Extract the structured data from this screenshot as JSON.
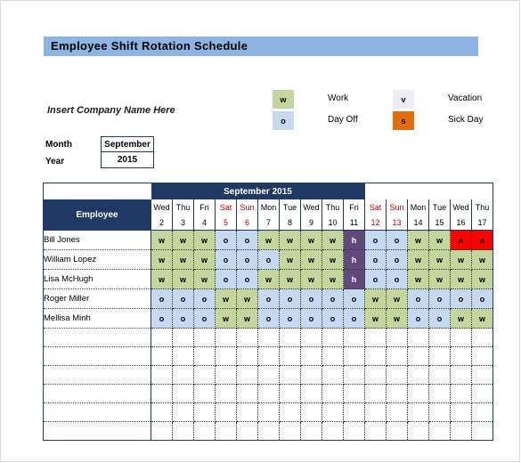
{
  "title": "Employee  Shift  Rotation  Schedule",
  "company_name": "Insert Company Name Here",
  "fields": {
    "month_label": "Month",
    "month_value": "September",
    "year_label": "Year",
    "year_value": "2015"
  },
  "legend": {
    "items": [
      {
        "code": "w",
        "label": "Work",
        "color": "#c3d69b",
        "text_color": "#000000"
      },
      {
        "code": "o",
        "label": "Day Off",
        "color": "#c5d9f1",
        "text_color": "#000000"
      },
      {
        "code": "v",
        "label": "Vacation",
        "color": "#eeecf4",
        "text_color": "#000000"
      },
      {
        "code": "s",
        "label": "Sick Day",
        "color": "#e36c0a",
        "text_color": "#000000"
      }
    ]
  },
  "table": {
    "month_banner": "September 2015",
    "employee_header": "Employee",
    "days": [
      {
        "dow": "Wed",
        "num": "2",
        "weekend": false
      },
      {
        "dow": "Thu",
        "num": "3",
        "weekend": false
      },
      {
        "dow": "Fri",
        "num": "4",
        "weekend": false
      },
      {
        "dow": "Sat",
        "num": "5",
        "weekend": true
      },
      {
        "dow": "Sun",
        "num": "6",
        "weekend": true
      },
      {
        "dow": "Mon",
        "num": "7",
        "weekend": false
      },
      {
        "dow": "Tue",
        "num": "8",
        "weekend": false
      },
      {
        "dow": "Wed",
        "num": "9",
        "weekend": false
      },
      {
        "dow": "Thu",
        "num": "10",
        "weekend": false
      },
      {
        "dow": "Fri",
        "num": "11",
        "weekend": false
      },
      {
        "dow": "Sat",
        "num": "12",
        "weekend": true
      },
      {
        "dow": "Sun",
        "num": "13",
        "weekend": true
      },
      {
        "dow": "Mon",
        "num": "14",
        "weekend": false
      },
      {
        "dow": "Tue",
        "num": "15",
        "weekend": false
      },
      {
        "dow": "Wed",
        "num": "16",
        "weekend": false
      },
      {
        "dow": "Thu",
        "num": "17",
        "weekend": false
      }
    ],
    "rows": [
      {
        "name": "Bill Jones",
        "cells": [
          "w",
          "w",
          "w",
          "o",
          "o",
          "w",
          "w",
          "w",
          "w",
          "h",
          "o",
          "o",
          "w",
          "w",
          "a",
          "a"
        ]
      },
      {
        "name": "William Lopez",
        "cells": [
          "w",
          "w",
          "w",
          "o",
          "o",
          "o",
          "w",
          "w",
          "w",
          "h",
          "o",
          "o",
          "w",
          "w",
          "w",
          "w"
        ]
      },
      {
        "name": "Lisa McHugh",
        "cells": [
          "w",
          "w",
          "w",
          "o",
          "o",
          "w",
          "w",
          "w",
          "w",
          "h",
          "o",
          "o",
          "w",
          "w",
          "w",
          "w"
        ]
      },
      {
        "name": "Roger Miller",
        "cells": [
          "o",
          "o",
          "o",
          "w",
          "w",
          "o",
          "o",
          "o",
          "o",
          "o",
          "w",
          "w",
          "o",
          "o",
          "o",
          "o"
        ]
      },
      {
        "name": "Mellisa Minh",
        "cells": [
          "o",
          "o",
          "o",
          "w",
          "w",
          "o",
          "o",
          "o",
          "o",
          "o",
          "w",
          "w",
          "o",
          "o",
          "w",
          "w"
        ]
      },
      {
        "name": "",
        "cells": [
          "",
          "",
          "",
          "",
          "",
          "",
          "",
          "",
          "",
          "",
          "",
          "",
          "",
          "",
          "",
          ""
        ]
      },
      {
        "name": "",
        "cells": [
          "",
          "",
          "",
          "",
          "",
          "",
          "",
          "",
          "",
          "",
          "",
          "",
          "",
          "",
          "",
          ""
        ]
      },
      {
        "name": "",
        "cells": [
          "",
          "",
          "",
          "",
          "",
          "",
          "",
          "",
          "",
          "",
          "",
          "",
          "",
          "",
          "",
          ""
        ]
      },
      {
        "name": "",
        "cells": [
          "",
          "",
          "",
          "",
          "",
          "",
          "",
          "",
          "",
          "",
          "",
          "",
          "",
          "",
          "",
          ""
        ]
      },
      {
        "name": "",
        "cells": [
          "",
          "",
          "",
          "",
          "",
          "",
          "",
          "",
          "",
          "",
          "",
          "",
          "",
          "",
          "",
          ""
        ]
      },
      {
        "name": "",
        "cells": [
          "",
          "",
          "",
          "",
          "",
          "",
          "",
          "",
          "",
          "",
          "",
          "",
          "",
          "",
          "",
          ""
        ]
      }
    ]
  },
  "cell_styles": {
    "w": "c-w",
    "o": "c-o",
    "v": "c-v",
    "s": "c-s",
    "h": "c-h",
    "a": "c-a",
    "": "c-blank"
  }
}
